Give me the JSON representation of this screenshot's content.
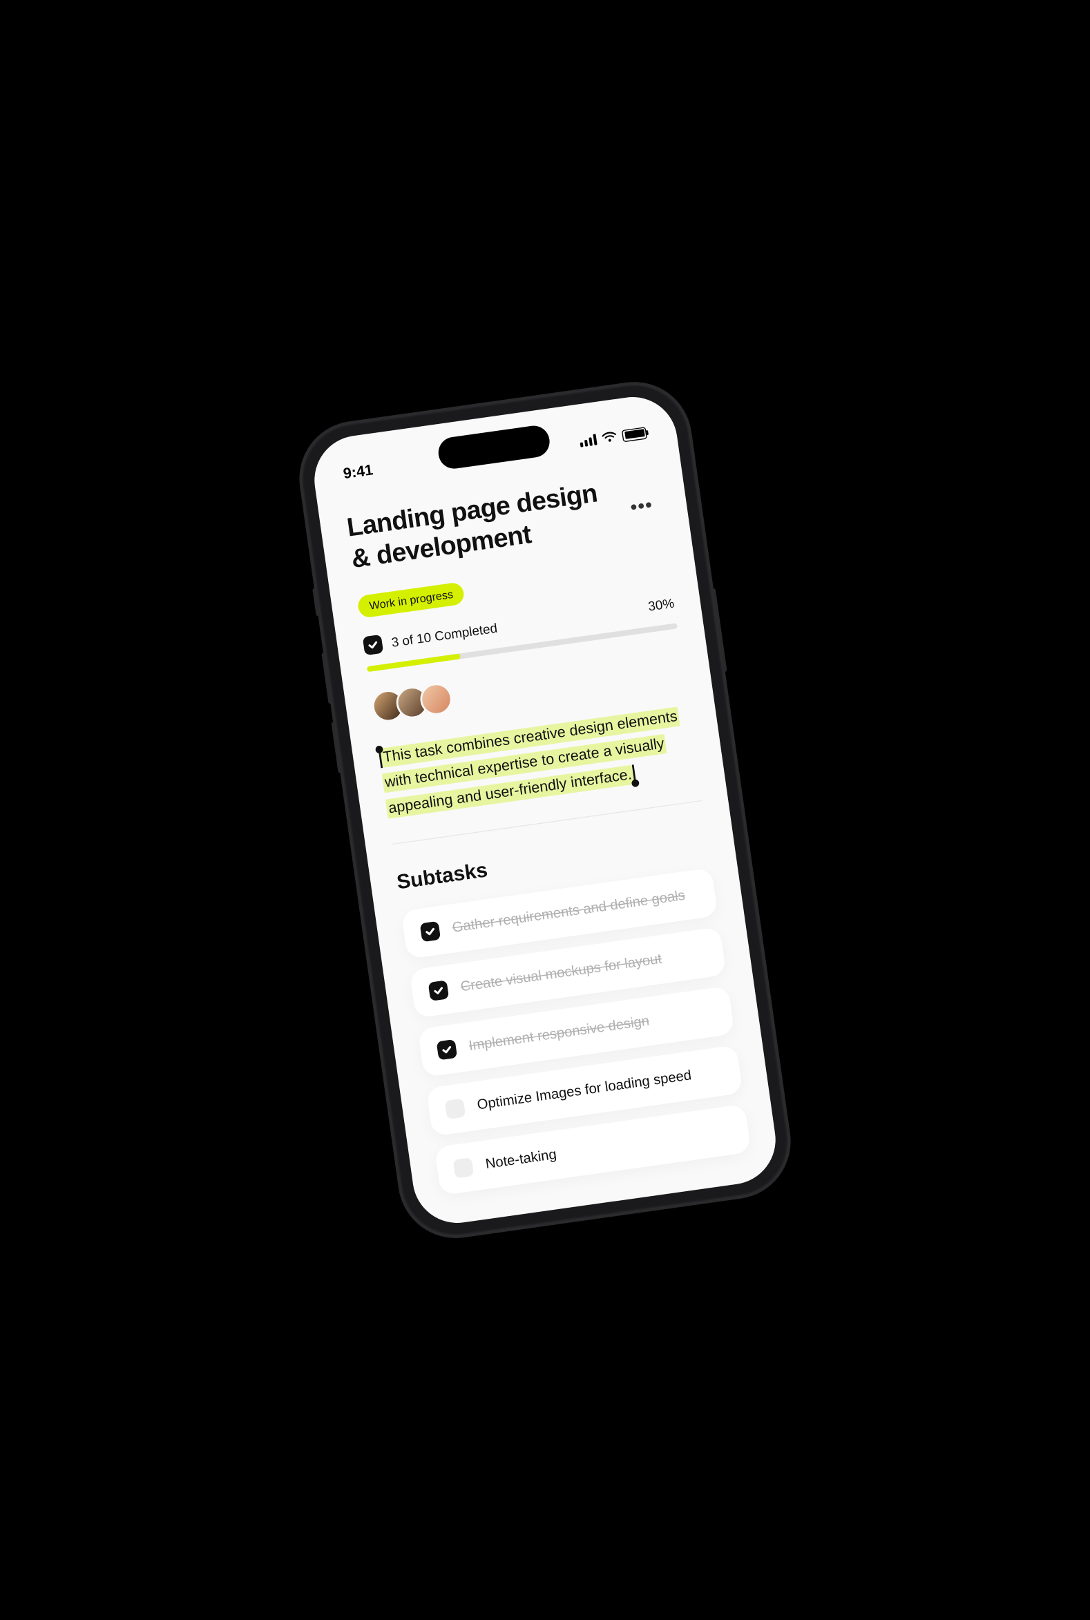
{
  "status_bar": {
    "time": "9:41"
  },
  "page": {
    "title": "Landing page design & development",
    "status_label": "Work in progress",
    "progress": {
      "text": "3 of 10 Completed",
      "percent_label": "30%",
      "percent_value": 30
    },
    "description": "This task combines creative design elements with technical expertise to create a visually appealing and user-friendly interface.",
    "colors": {
      "accent": "#d4f000",
      "highlight": "#e8f5a0"
    }
  },
  "subtasks": {
    "heading": "Subtasks",
    "items": [
      {
        "label": "Gather requirements and define goals",
        "completed": true
      },
      {
        "label": "Create visual mockups for layout",
        "completed": true
      },
      {
        "label": "Implement responsive design",
        "completed": true
      },
      {
        "label": "Optimize Images for loading speed",
        "completed": false
      },
      {
        "label": "Note-taking",
        "completed": false
      }
    ]
  }
}
